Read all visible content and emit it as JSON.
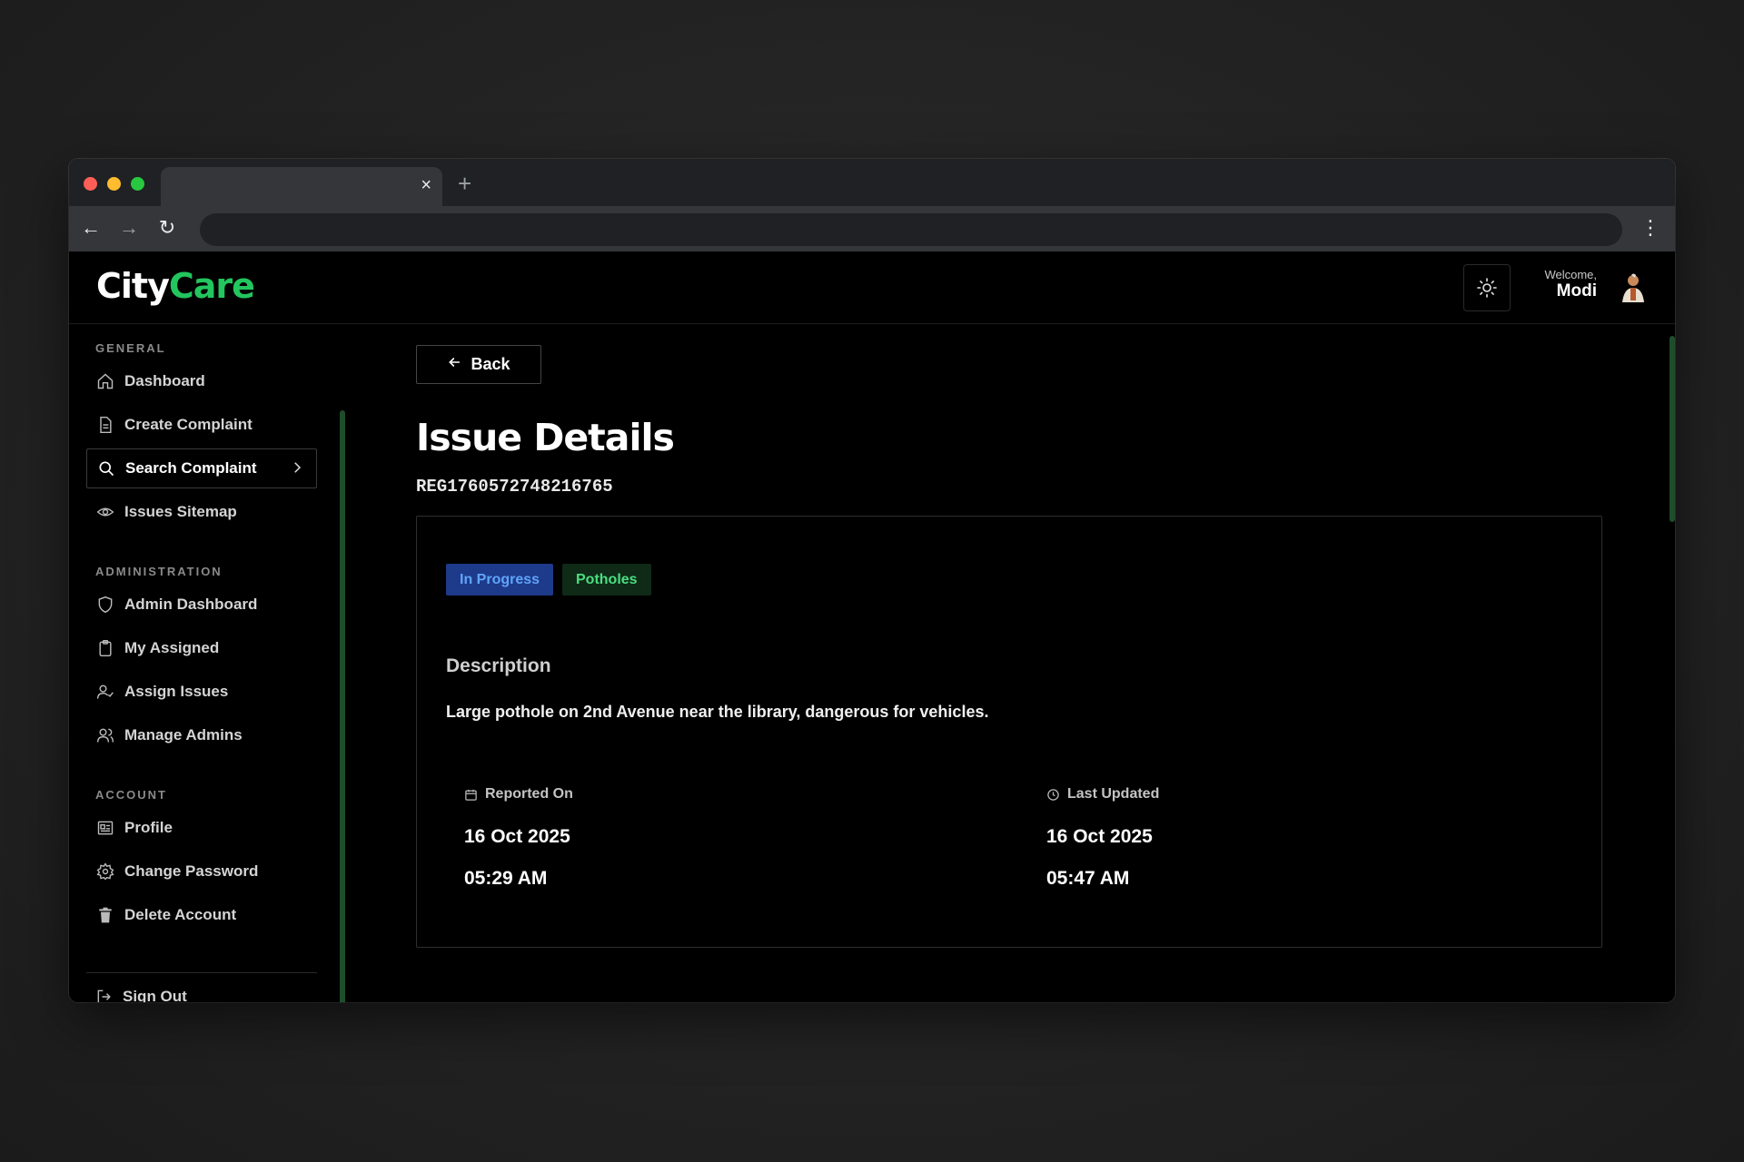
{
  "browser": {
    "tab_close": "×",
    "new_tab": "+",
    "back": "←",
    "forward": "→",
    "reload": "↻",
    "menu": "⋮",
    "address": ""
  },
  "header": {
    "logo_part1": "City",
    "logo_part2": "Care",
    "welcome_label": "Welcome,",
    "user_name": "Modi",
    "theme_icon": "sun-icon"
  },
  "sidebar": {
    "sections": [
      {
        "label": "GENERAL"
      },
      {
        "label": "ADMINISTRATION"
      },
      {
        "label": "ACCOUNT"
      }
    ],
    "items": [
      {
        "label": "Dashboard",
        "icon": "home-icon"
      },
      {
        "label": "Create Complaint",
        "icon": "file-icon"
      },
      {
        "label": "Search Complaint",
        "icon": "search-icon",
        "active": true
      },
      {
        "label": "Issues Sitemap",
        "icon": "eye-icon"
      },
      {
        "label": "Admin Dashboard",
        "icon": "shield-icon"
      },
      {
        "label": "My Assigned",
        "icon": "clipboard-icon"
      },
      {
        "label": "Assign Issues",
        "icon": "user-check-icon"
      },
      {
        "label": "Manage Admins",
        "icon": "users-icon"
      },
      {
        "label": "Profile",
        "icon": "id-card-icon"
      },
      {
        "label": "Change Password",
        "icon": "gear-icon"
      },
      {
        "label": "Delete Account",
        "icon": "trash-icon"
      }
    ],
    "signout": "Sign Out"
  },
  "main": {
    "back_label": "Back",
    "title": "Issue Details",
    "registration_id": "REG1760572748216765",
    "status_badge": "In Progress",
    "category_badge": "Potholes",
    "description_title": "Description",
    "description_text": "Large pothole on 2nd Avenue near the library, dangerous for vehicles.",
    "reported": {
      "label": "Reported On",
      "date": "16 Oct 2025",
      "time": "05:29 AM"
    },
    "updated": {
      "label": "Last Updated",
      "date": "16 Oct 2025",
      "time": "05:47 AM"
    }
  },
  "colors": {
    "accent": "#22c55e",
    "status_bg": "#1e3a8a",
    "status_text": "#60a5fa",
    "category_bg": "#0f2a17",
    "category_text": "#4ade80"
  }
}
